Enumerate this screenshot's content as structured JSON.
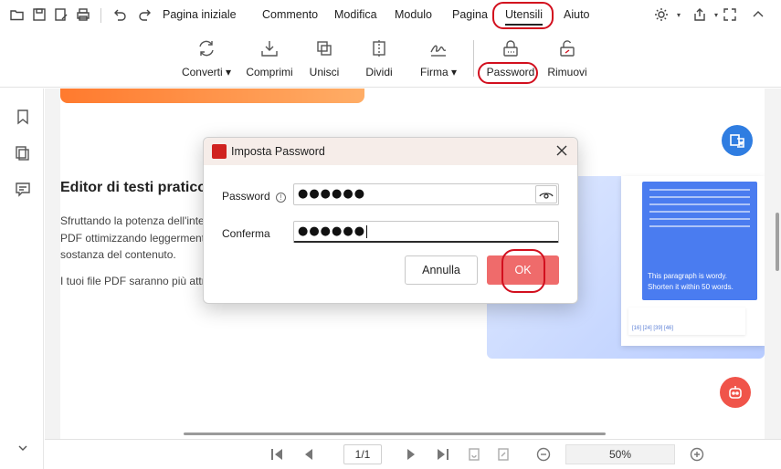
{
  "menubar": {
    "items": [
      "Pagina iniziale",
      "Commento",
      "Modifica",
      "Modulo",
      "Pagina",
      "Utensili",
      "Aiuto"
    ],
    "active": "Utensili"
  },
  "ribbon": {
    "tools": [
      {
        "label": "Converti ▾",
        "icon": "convert-icon"
      },
      {
        "label": "Comprimi",
        "icon": "compress-icon"
      },
      {
        "label": "Unisci",
        "icon": "merge-icon"
      },
      {
        "label": "Dividi",
        "icon": "split-icon"
      },
      {
        "label": "Firma ▾",
        "icon": "signature-icon"
      },
      {
        "label": "Password",
        "icon": "lock-icon"
      },
      {
        "label": "Rimuovi",
        "icon": "unlock-icon"
      }
    ]
  },
  "document": {
    "heading": "Editor di testi pratico",
    "lines": [
      "Sfruttando la potenza dell'inte",
      "PDF ottimizzando leggerment",
      "sostanza del contenuto.",
      "I tuoi file PDF saranno più attr"
    ],
    "illustration_text": "This paragraph is wordy. Shorten it within 50 words.",
    "illustration_refs": "[16] [24] [39] [46]"
  },
  "bottombar": {
    "page": "1/1",
    "zoom": "50%"
  },
  "dialog": {
    "title": "Imposta Password",
    "password_label": "Password",
    "password_value": "●●●●●●",
    "confirm_label": "Conferma",
    "confirm_value": "●●●●●●",
    "cancel_label": "Annulla",
    "ok_label": "OK"
  },
  "colors": {
    "accent_red": "#d20f1e",
    "ok_button": "#ef6b6b",
    "word_blue": "#2f7de1",
    "bot_red": "#f0544a"
  }
}
